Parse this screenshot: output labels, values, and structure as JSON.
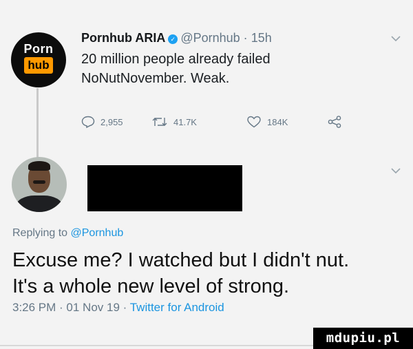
{
  "tweet1": {
    "avatar": {
      "logo_top": "Porn",
      "logo_box": "hub"
    },
    "author_name": "Pornhub ARIA",
    "handle": "@Pornhub",
    "separator": "·",
    "time": "15h",
    "text_line1": "20 million people already failed",
    "text_line2": "NoNutNovember. Weak.",
    "replies": "2,955",
    "retweets": "41.7K",
    "likes": "184K"
  },
  "tweet2": {
    "replying_prefix": "Replying to",
    "replying_handle": "@Pornhub",
    "text_line1": "Excuse me? I watched but I didn't nut.",
    "text_line2": "It's a whole new level of strong.",
    "timestamp": "3:26 PM · 01 Nov 19 ·",
    "app": "Twitter for Android"
  },
  "watermark": "mdupiu.pl",
  "colors": {
    "accent": "#1b95e0",
    "verified": "#1da1f2",
    "logo_orange": "#ff9900",
    "meta_gray": "#657786"
  },
  "icons": [
    "reply-icon",
    "retweet-icon",
    "like-icon",
    "share-icon",
    "chevron-down-icon",
    "verified-badge-icon"
  ]
}
